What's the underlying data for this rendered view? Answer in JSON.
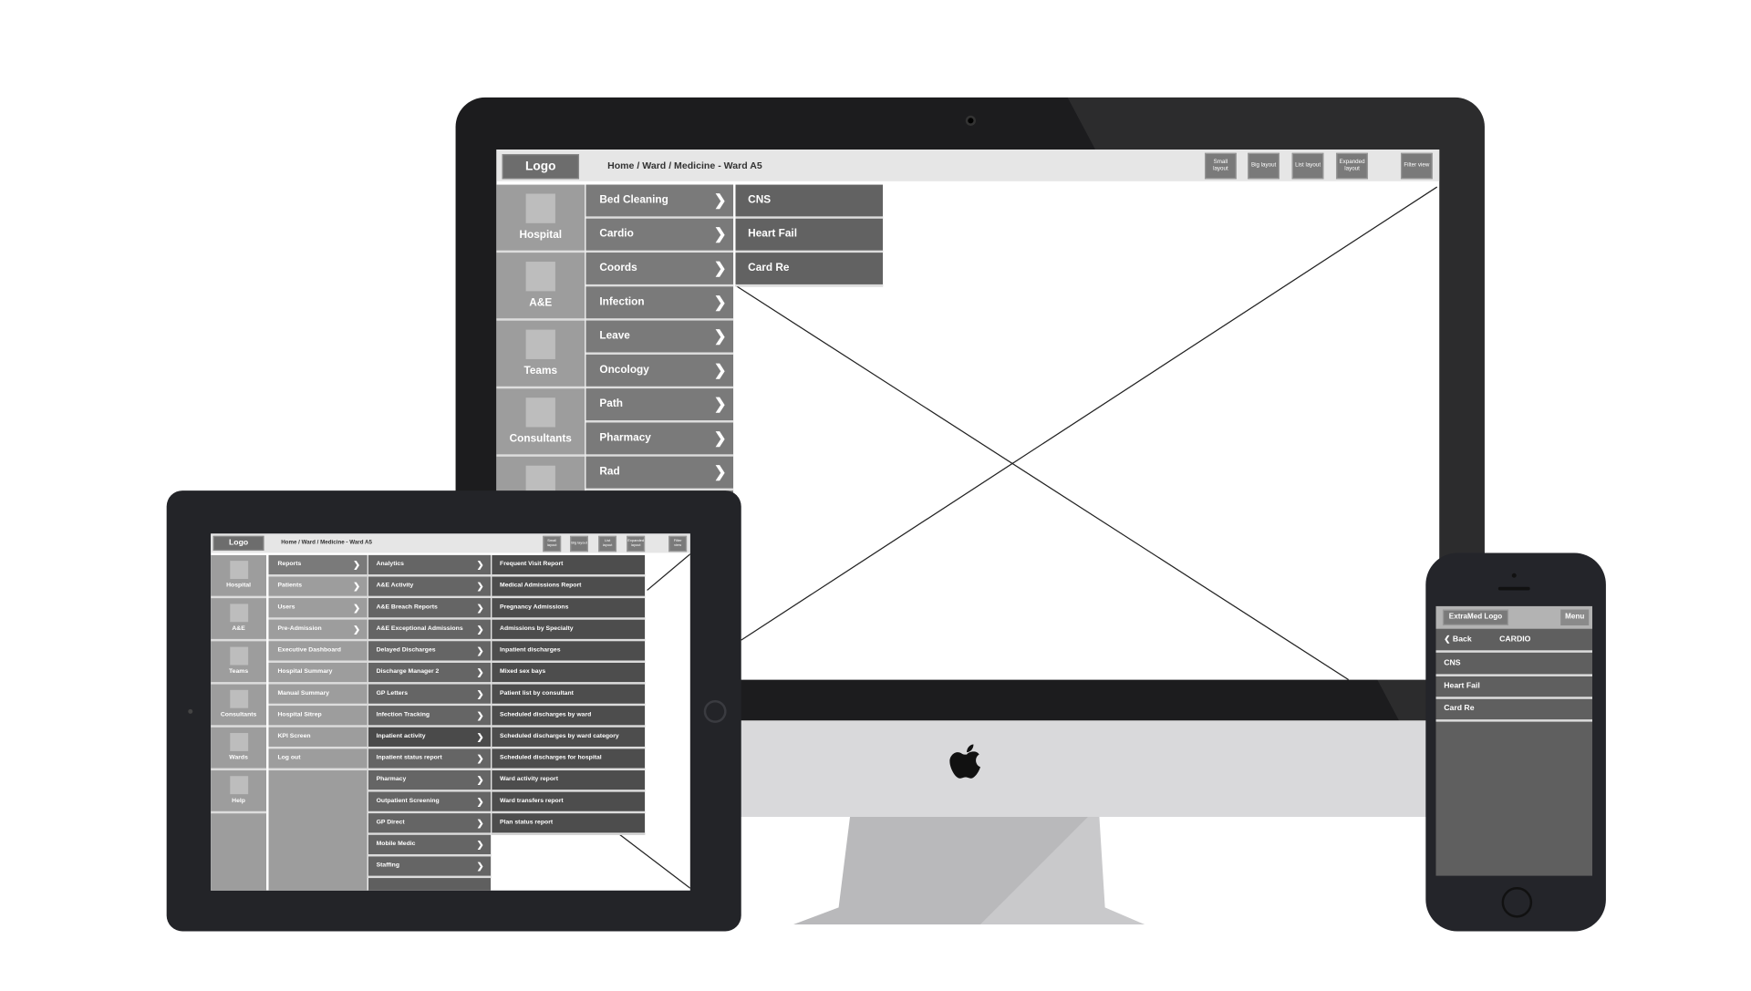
{
  "imac": {
    "logo": "Logo",
    "breadcrumb": "Home / Ward / Medicine - Ward A5",
    "layout_buttons": [
      "Small layout",
      "Big layout",
      "List layout",
      "Expanded layout",
      "Filter view"
    ],
    "sidebar": [
      "Hospital",
      "A&E",
      "Teams",
      "Consultants",
      ""
    ],
    "menu": [
      "Bed Cleaning",
      "Cardio",
      "Coords",
      "Infection",
      "Leave",
      "Oncology",
      "Path",
      "Pharmacy",
      "Rad"
    ],
    "submenu": [
      "CNS",
      "Heart Fail",
      "Card Re"
    ]
  },
  "tablet": {
    "logo": "Logo",
    "breadcrumb": "Home / Ward / Medicine - Ward A5",
    "layout_buttons": [
      "Small layout",
      "Big layout",
      "List layout",
      "Expanded layout",
      "Filter view"
    ],
    "sidebar": [
      "Hospital",
      "A&E",
      "Teams",
      "Consultants",
      "Wards",
      "Help"
    ],
    "menu": [
      "Reports",
      "Patients",
      "Users",
      "Pre-Admission",
      "Executive Dashboard",
      "Hospital Summary",
      "Manual Summary",
      "Hospital Sitrep",
      "KPI Screen",
      "Log out"
    ],
    "menu_has_children": [
      true,
      true,
      true,
      true,
      false,
      false,
      false,
      false,
      false,
      false
    ],
    "reports": [
      "Analytics",
      "A&E Activity",
      "A&E Breach Reports",
      "A&E Exceptional Admissions",
      "Delayed Discharges",
      "Discharge Manager 2",
      "GP Letters",
      "Infection Tracking",
      "Inpatient activity",
      "Inpatient status report",
      "Pharmacy",
      "Outpatient Screening",
      "GP Direct",
      "Mobile Medic",
      "Staffing"
    ],
    "inpatient_activity": [
      "Frequent Visit Report",
      "Medical Admissions Report",
      "Pregnancy Admissions",
      "Admissions by Specialty",
      "Inpatient discharges",
      "Mixed sex bays",
      "Patient list by consultant",
      "Scheduled discharges by ward",
      "Scheduled discharges by ward category",
      "Scheduled discharges for hospital",
      "Ward activity report",
      "Ward transfers report",
      "Plan status report"
    ]
  },
  "phone": {
    "logo": "ExtraMed Logo",
    "menu": "Menu",
    "back": "Back",
    "title": "CARDIO",
    "items": [
      "CNS",
      "Heart Fail",
      "Card Re"
    ]
  },
  "colors": {
    "device": "#232428",
    "menu_grey": "#7a7a7a",
    "sidebar_grey": "#9d9d9d",
    "submenu_dark": "#5f5f5f"
  }
}
